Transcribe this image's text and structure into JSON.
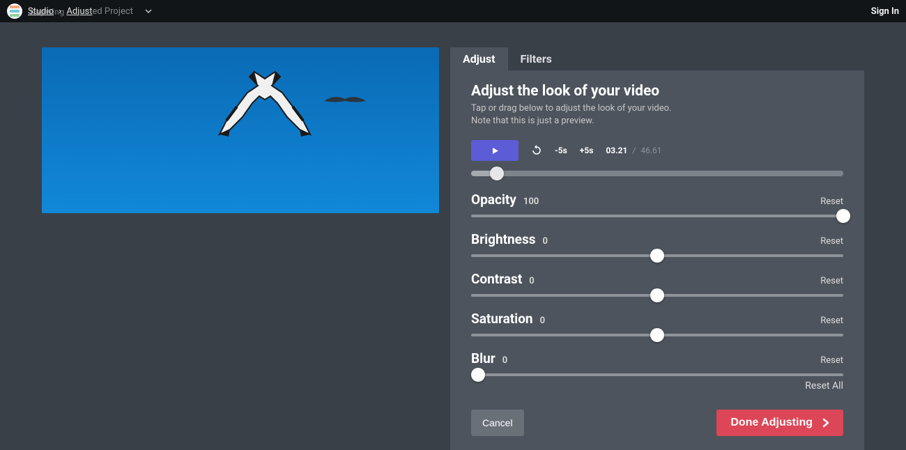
{
  "topbar": {
    "breadcrumb_studio": "Studio",
    "breadcrumb_sep": "›",
    "breadcrumb_adjust": "Adjust",
    "breadcrumb_project_suffix": "ed Project",
    "brand_overlay": "Kapwing",
    "signin": "Sign In"
  },
  "tabs": {
    "adjust": "Adjust",
    "filters": "Filters"
  },
  "panel": {
    "title": "Adjust the look of your video",
    "sub1": "Tap or drag below to adjust the look of your video.",
    "sub2": "Note that this is just a preview."
  },
  "playback": {
    "minus5": "-5s",
    "plus5": "+5s",
    "current": "03.21",
    "slash": "/",
    "total": "46.61",
    "progress_pct": 6.9
  },
  "sliders": [
    {
      "label": "Opacity",
      "value": "100",
      "reset": "Reset",
      "thumb_pct": 100
    },
    {
      "label": "Brightness",
      "value": "0",
      "reset": "Reset",
      "thumb_pct": 50
    },
    {
      "label": "Contrast",
      "value": "0",
      "reset": "Reset",
      "thumb_pct": 50
    },
    {
      "label": "Saturation",
      "value": "0",
      "reset": "Reset",
      "thumb_pct": 50
    },
    {
      "label": "Blur",
      "value": "0",
      "reset": "Reset",
      "thumb_pct": 1.8
    }
  ],
  "reset_all": "Reset All",
  "buttons": {
    "cancel": "Cancel",
    "done": "Done Adjusting"
  },
  "colors": {
    "accent": "#5c5cd6",
    "danger": "#dd4656"
  }
}
